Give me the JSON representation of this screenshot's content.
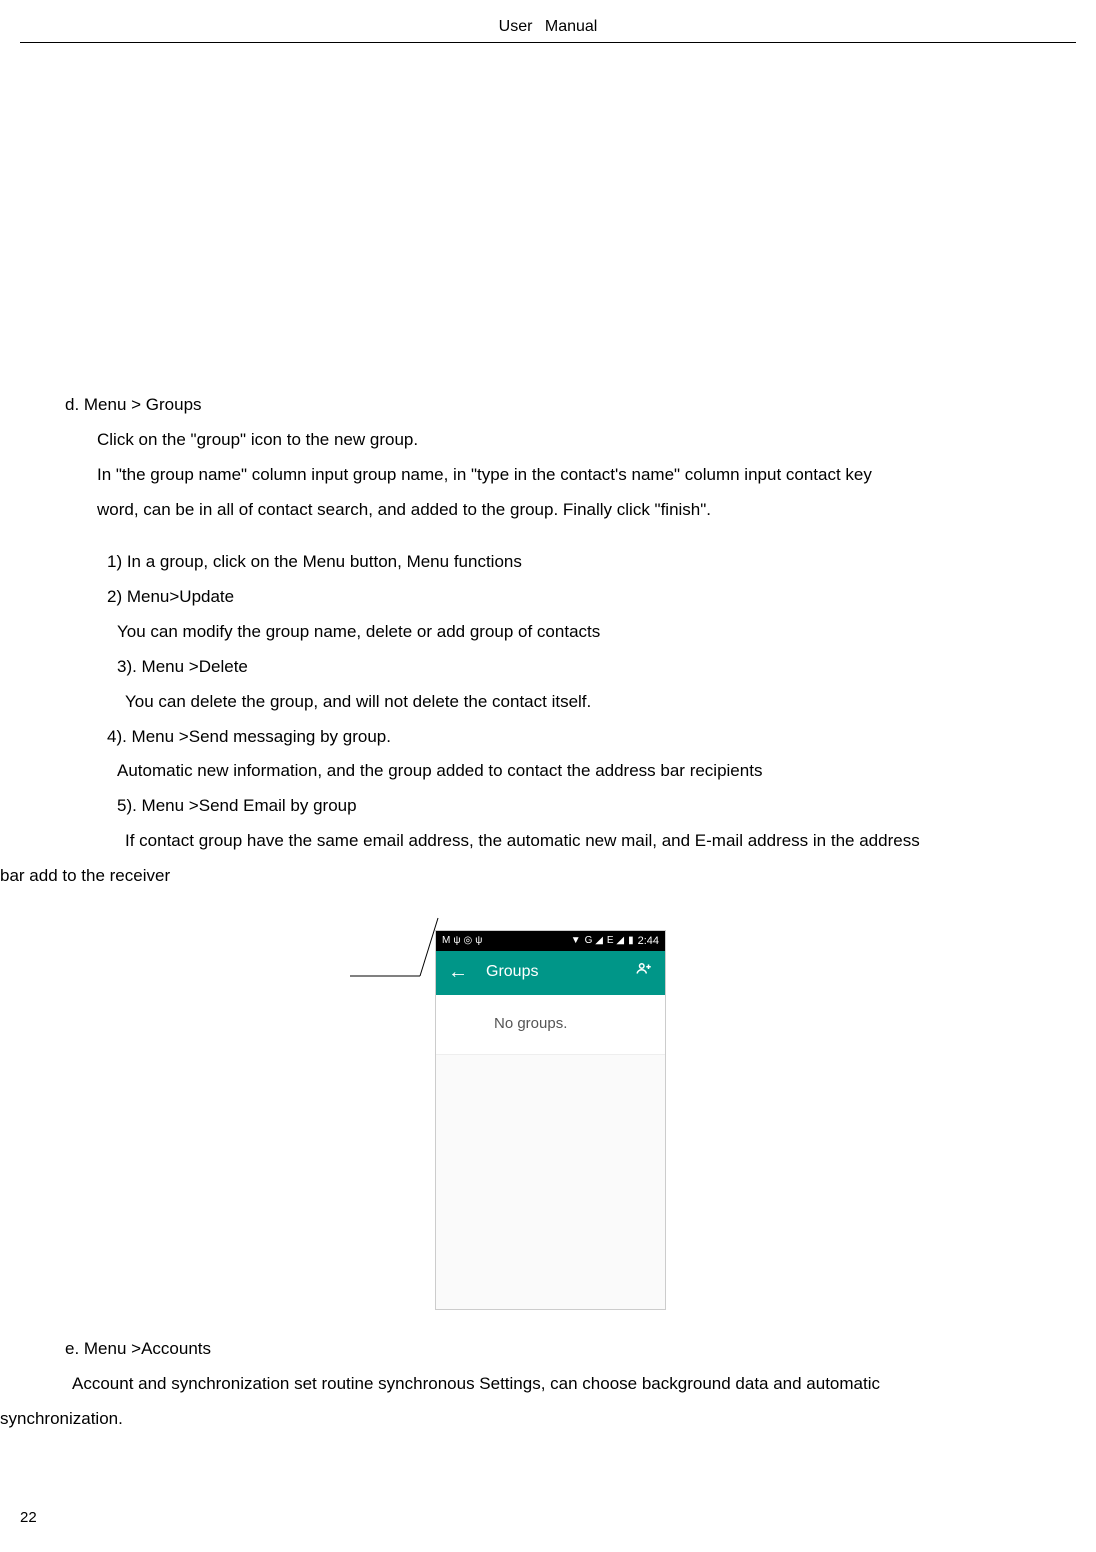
{
  "header": {
    "title": "User  Manual"
  },
  "section_d": {
    "heading": "d.    Menu > Groups",
    "line_click": "Click on the \"group\" icon to the new group.",
    "line_input1": "In \"the group name\" column input group name, in \"type in the contact's name\" column input contact key",
    "line_input2": "word, can be in all of contact search, and added to the group.  Finally click \"finish\".",
    "item1": "1)    In a group, click on the Menu button,    Menu functions",
    "item2": "2)    Menu>Update",
    "item2_desc": "You can modify the group name, delete or add group of contacts",
    "item3": "3).    Menu >Delete",
    "item3_desc": "You can delete the group, and will not delete the contact itself.",
    "item4": "4).    Menu >Send messaging by group.",
    "item4_desc": "Automatic new information, and the group added to contact the address bar recipients",
    "item5": "5).    Menu >Send Email by group",
    "item5_desc": "If contact group have the same email address, the automatic new mail, and E-mail address in the address",
    "item5_desc2": "bar add to the receiver"
  },
  "screenshot": {
    "status_left_icons": [
      "M",
      "ψ",
      "◎",
      "ψ"
    ],
    "status_wifi": "▼",
    "status_signal": "G ◢",
    "status_signal2": "E ◢",
    "status_battery": "▮",
    "status_time": "2:44",
    "appbar_back": "←",
    "appbar_title": "Groups",
    "no_groups_text": "No groups."
  },
  "section_e": {
    "heading": "e.    Menu >Accounts",
    "line1": "Account and synchronization set routine synchronous Settings, can choose background data and automatic",
    "line2": "synchronization."
  },
  "page_number": "22"
}
